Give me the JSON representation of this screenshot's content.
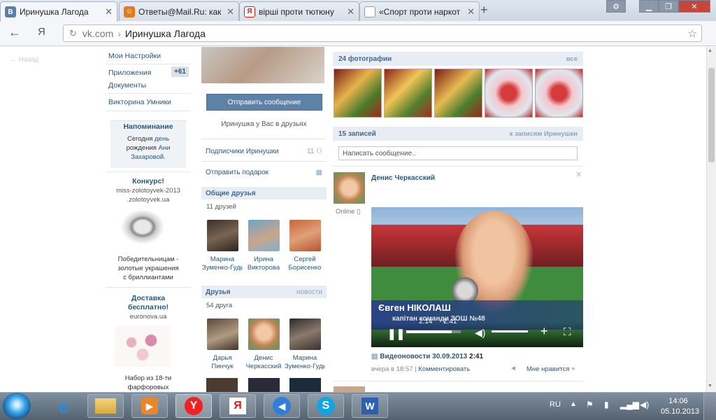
{
  "browser": {
    "tabs": [
      {
        "title": "Иринушка Лагода",
        "icon": "В",
        "icon_color": "#5b7fa6"
      },
      {
        "title": "Ответы@Mail.Ru: как",
        "icon": "☺",
        "icon_color": "#e27b1d"
      },
      {
        "title": "вірші проти тютюну",
        "icon": "Я",
        "icon_color": "#d81e1e"
      },
      {
        "title": "«Спорт проти наркот",
        "icon": "",
        "icon_color": "#ffffff"
      }
    ],
    "new_tab": "+",
    "address": {
      "domain": "vk.com",
      "separator": "›",
      "page": "Иринушка Лагода"
    },
    "back_glyph": "←",
    "yandex_glyph": "Я"
  },
  "vk": {
    "nav_back": "Назад",
    "menu": {
      "settings": "Мои Настройки",
      "apps": "Приложения",
      "apps_badge": "+61",
      "documents": "Документы",
      "quiz": "Викторина Умники"
    },
    "reminder": {
      "title": "Напоминание",
      "line1": "Сегодня",
      "link1": "день",
      "line2": "рождения",
      "link2": "Ани",
      "line3": "Захаровой."
    },
    "ads": [
      {
        "title": "Конкурс!",
        "line1": "miss-zolotoyvek-2013",
        "line2": ".zolotoyvek.ua",
        "text1": "Победительницам -",
        "text2": "золотые украшения",
        "text3": "с бриллиантами"
      },
      {
        "title1": "Доставка",
        "title2": "бесплатно!",
        "domain": "euronova.ua",
        "text1": "Набор из 18-ти",
        "text2": "фарфоровых"
      }
    ],
    "profile": {
      "send_message": "Отправить сообщение",
      "in_friends": "Иринушка у Вас в друзьях",
      "followers": "Подписчики Иринушки",
      "followers_count": "11",
      "send_gift": "Отправить подарок",
      "mutual_title": "Общие друзья",
      "mutual_count": "11 друзей",
      "mutual": [
        {
          "first": "Марина",
          "last": "Зуменко-Гудь"
        },
        {
          "first": "Ирина",
          "last": "Викторова"
        },
        {
          "first": "Сергей",
          "last": "Борисенко"
        }
      ],
      "friends_title": "Друзья",
      "friends_news": "новости",
      "friends_count": "54 друга",
      "friends": [
        {
          "first": "Дарья",
          "last": "Пинчук"
        },
        {
          "first": "Денис",
          "last": "Черкасский"
        },
        {
          "first": "Марина",
          "last": "Зуменко-Гудь"
        }
      ]
    },
    "photos": {
      "title": "24 фотографии",
      "all": "все"
    },
    "wall": {
      "title": "15 записей",
      "to_posts": "к записям Иринушки",
      "placeholder": "Написать сообщение..",
      "post": {
        "author": "Денис Черкасский",
        "online": "Online",
        "video_caption_name": "Євген НІКОЛАШ",
        "video_caption_sub": "капітан команди ЗОШ №48",
        "time_current": "2:14",
        "time_total": "2:41",
        "video_title": "Видеоновости 30.09.2013",
        "video_duration": "2:41",
        "date": "вчера в 18:57",
        "comment": "Комментировать",
        "like": "Мне нравится"
      }
    }
  },
  "taskbar": {
    "lang": "RU",
    "time": "14:06",
    "date": "05.10.2013"
  }
}
